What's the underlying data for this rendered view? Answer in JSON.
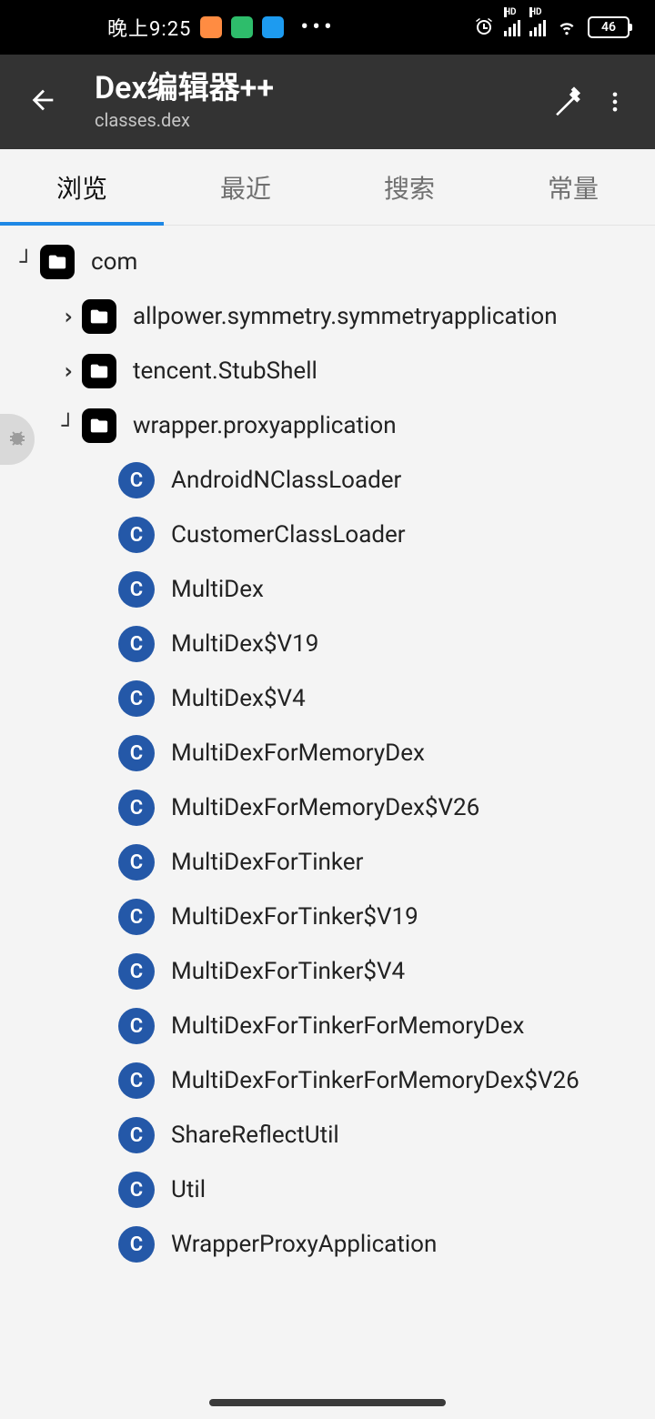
{
  "status": {
    "time": "晚上9:25",
    "battery": "46",
    "app_icons": [
      "#ff8c42",
      "#2ebd6b",
      "#1d9bf0"
    ]
  },
  "appbar": {
    "title": "Dex编辑器++",
    "subtitle": "classes.dex"
  },
  "tabs": {
    "browse": "浏览",
    "recent": "最近",
    "search": "搜索",
    "const": "常量",
    "selected": 0
  },
  "tree": {
    "root": "com",
    "children": [
      {
        "type": "pkg",
        "state": "collapsed",
        "label": "allpower.symmetry.symmetryapplication"
      },
      {
        "type": "pkg",
        "state": "collapsed",
        "label": "tencent.StubShell"
      },
      {
        "type": "pkg",
        "state": "expanded",
        "label": "wrapper.proxyapplication",
        "classes": [
          "AndroidNClassLoader",
          "CustomerClassLoader",
          "MultiDex",
          "MultiDex$V19",
          "MultiDex$V4",
          "MultiDexForMemoryDex",
          "MultiDexForMemoryDex$V26",
          "MultiDexForTinker",
          "MultiDexForTinker$V19",
          "MultiDexForTinker$V4",
          "MultiDexForTinkerForMemoryDex",
          "MultiDexForTinkerForMemoryDex$V26",
          "ShareReflectUtil",
          "Util",
          "WrapperProxyApplication"
        ]
      }
    ]
  }
}
